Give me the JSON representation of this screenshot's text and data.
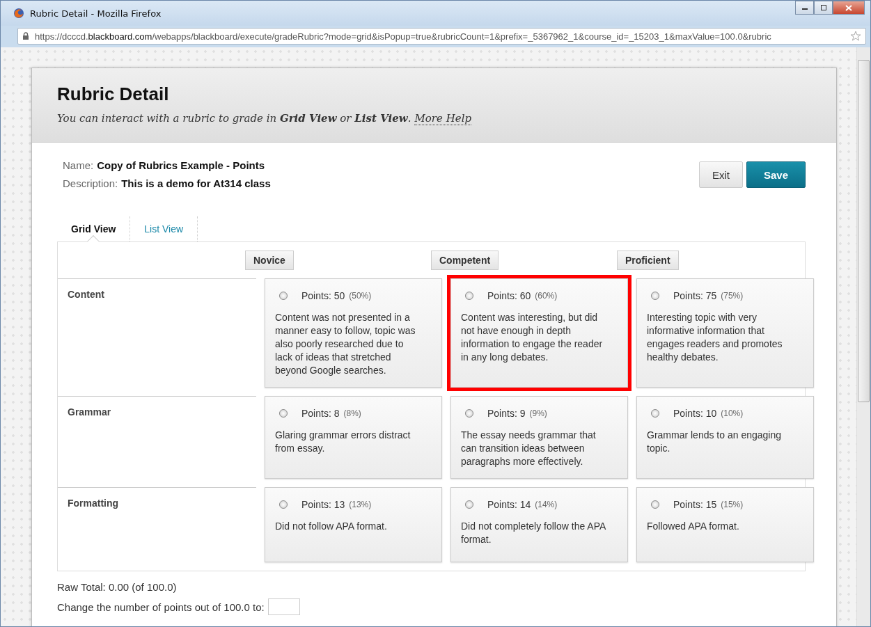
{
  "window": {
    "title": "Rubric Detail - Mozilla Firefox",
    "url": "https://dcccd.**blackboard.com**/webapps/blackboard/execute/gradeRubric?mode=grid&isPopup=true&rubricCount=1&prefix=_5367962_1&course_id=_15203_1&maxValue=100.0&rubric"
  },
  "header": {
    "title": "Rubric Detail",
    "subtitle": "You can interact with a rubric to grade in **Grid View** or **List View**.",
    "help_link": "More Help"
  },
  "details": [
    {
      "label": "Name:",
      "value": "Copy of Rubrics Example - Points"
    },
    {
      "label": "Description:",
      "value": "This is a demo for At314 class"
    }
  ],
  "buttons": [
    {
      "label": "Exit",
      "kind": "secondary"
    },
    {
      "label": "Save",
      "kind": "primary"
    }
  ],
  "tabs": [
    {
      "label": "Grid View",
      "selected": true
    },
    {
      "label": "List View",
      "selected": false
    }
  ],
  "columns": [
    "Novice",
    "Competent",
    "Proficient"
  ],
  "rows": [
    {
      "criterion": "Content",
      "cells": [
        {
          "points": "Points: 50",
          "percent": "(50%)",
          "description": "Content was not presented in a manner easy to follow, topic was also poorly researched due to lack of ideas that stretched beyond Google searches.",
          "selected": false,
          "highlighted": false
        },
        {
          "points": "Points: 60",
          "percent": "(60%)",
          "description": "Content was interesting, but did not have enough in depth information to engage the reader in any long debates.",
          "selected": false,
          "highlighted": true
        },
        {
          "points": "Points: 75",
          "percent": "(75%)",
          "description": "Interesting topic with very informative information that engages readers and promotes healthy debates.",
          "selected": false,
          "highlighted": false
        }
      ]
    },
    {
      "criterion": "Grammar",
      "cells": [
        {
          "points": "Points: 8",
          "percent": "(8%)",
          "description": "Glaring grammar errors distract from essay.",
          "selected": false,
          "highlighted": false
        },
        {
          "points": "Points: 9",
          "percent": "(9%)",
          "description": "The essay needs grammar that can transition ideas between paragraphs more effectively.",
          "selected": false,
          "highlighted": false
        },
        {
          "points": "Points: 10",
          "percent": "(10%)",
          "description": "Grammar lends to an engaging topic.",
          "selected": false,
          "highlighted": false
        }
      ]
    },
    {
      "criterion": "Formatting",
      "cells": [
        {
          "points": "Points: 13",
          "percent": "(13%)",
          "description": "Did not follow APA format.",
          "selected": false,
          "highlighted": false
        },
        {
          "points": "Points: 14",
          "percent": "(14%)",
          "description": "Did not completely follow the APA format.",
          "selected": false,
          "highlighted": false
        },
        {
          "points": "Points: 15",
          "percent": "(15%)",
          "description": "Followed APA format.",
          "selected": false,
          "highlighted": false
        }
      ]
    }
  ],
  "footer": {
    "raw_total": "Raw Total: 0.00 (of 100.0)",
    "change_label": "Change the number of points out of 100.0 to:"
  }
}
